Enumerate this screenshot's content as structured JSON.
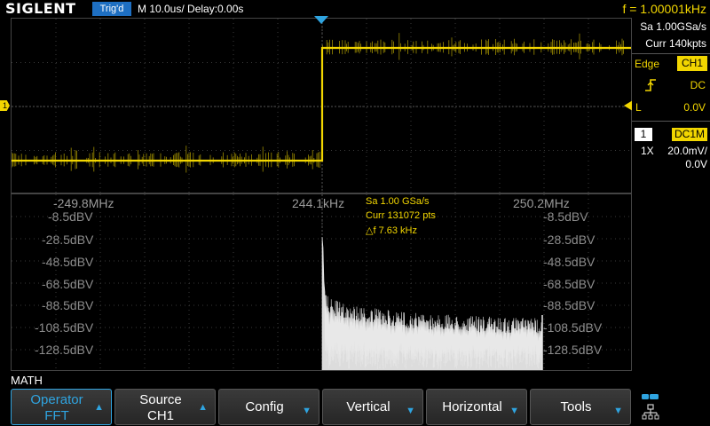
{
  "topbar": {
    "logo": "SIGLENT",
    "trigger_status": "Trig'd",
    "timebase": "M 10.0us/  Delay:0.00s",
    "frequency": "f = 1.00001kHz"
  },
  "acquisition": {
    "sample_rate": "Sa 1.00GSa/s",
    "memory": "Curr 140kpts"
  },
  "trigger": {
    "type": "Edge",
    "source": "CH1",
    "slope_icon": "rising-edge-icon",
    "coupling": "DC",
    "level_label": "L",
    "level": "0.0V"
  },
  "channel1": {
    "number": "1",
    "impedance": "DC1M",
    "probe": "1X",
    "scale": "20.0mV/",
    "offset": "0.0V",
    "marker": "1",
    "color": "#f2d600"
  },
  "fft": {
    "freq_left": "-249.8MHz",
    "freq_center": "244.1kHz",
    "freq_right": "250.2MHz",
    "dbv_left": [
      "-8.5dBV",
      "-28.5dBV",
      "-48.5dBV",
      "-68.5dBV",
      "-88.5dBV",
      "-108.5dBV",
      "-128.5dBV"
    ],
    "dbv_right": [
      "-8.5dBV",
      "-28.5dBV",
      "-48.5dBV",
      "-68.5dBV",
      "-88.5dBV",
      "-108.5dBV",
      "-128.5dBV"
    ],
    "info_sample_rate": "Sa 1.00 GSa/s",
    "info_points": "Curr 131072 pts",
    "info_resolution": "△f 7.63 kHz"
  },
  "menu": {
    "title": "MATH",
    "softkeys": [
      {
        "line1": "Operator",
        "line2": "FFT",
        "active": true
      },
      {
        "line1": "Source",
        "line2": "CH1"
      },
      {
        "label": "Config"
      },
      {
        "label": "Vertical"
      },
      {
        "label": "Horizontal"
      },
      {
        "label": "Tools"
      }
    ]
  },
  "icons": {
    "network": "network-icon",
    "trigger_position": "trigger-position-icon"
  }
}
